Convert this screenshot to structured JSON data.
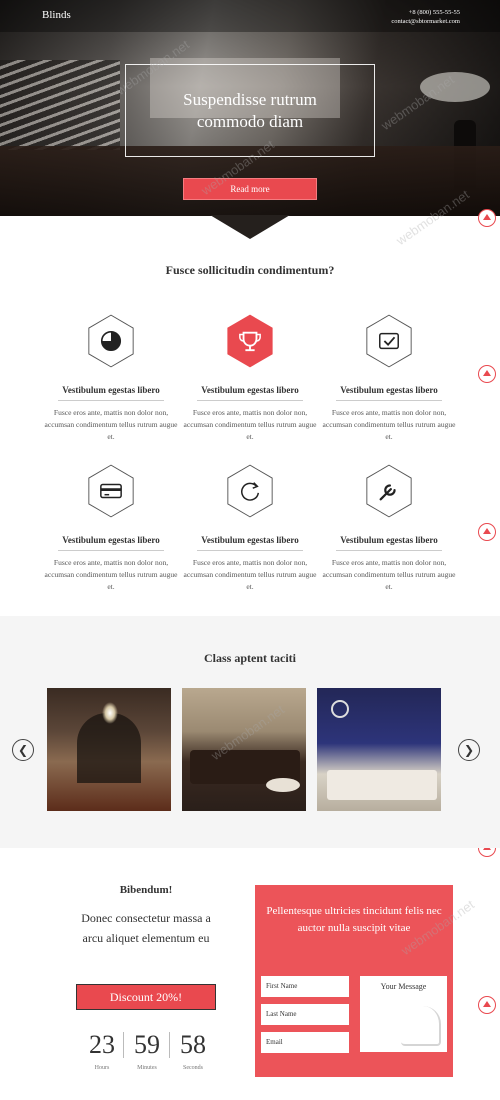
{
  "header": {
    "brand": "Blinds",
    "phone": "+8 (800) 555-55-55",
    "email": "contact@sbtormarket.com"
  },
  "hero": {
    "title": "Suspendisse rutrum commodo diam",
    "button_label": "Read more"
  },
  "features": {
    "title": "Fusce sollicitudin condimentum?",
    "items": [
      {
        "icon": "pie-chart-icon",
        "title": "Vestibulum egestas libero",
        "text": "Fusce eros ante, mattis non dolor non, accumsan condimentum tellus rutrum augue et.",
        "active": false
      },
      {
        "icon": "trophy-icon",
        "title": "Vestibulum egestas libero",
        "text": "Fusce eros ante, mattis non dolor non, accumsan condimentum tellus rutrum augue et.",
        "active": true
      },
      {
        "icon": "check-icon",
        "title": "Vestibulum egestas libero",
        "text": "Fusce eros ante, mattis non dolor non, accumsan condimentum tellus rutrum augue et.",
        "active": false
      },
      {
        "icon": "credit-card-icon",
        "title": "Vestibulum egestas libero",
        "text": "Fusce eros ante, mattis non dolor non, accumsan condimentum tellus rutrum augue et.",
        "active": false
      },
      {
        "icon": "refresh-icon",
        "title": "Vestibulum egestas libero",
        "text": "Fusce eros ante, mattis non dolor non, accumsan condimentum tellus rutrum augue et.",
        "active": false
      },
      {
        "icon": "wrench-icon",
        "title": "Vestibulum egestas libero",
        "text": "Fusce eros ante, mattis non dolor non, accumsan condimentum tellus rutrum augue et.",
        "active": false
      }
    ]
  },
  "gallery": {
    "title": "Class aptent taciti",
    "prev_icon": "chevron-left-icon",
    "next_icon": "chevron-right-icon",
    "prev_glyph": "❮",
    "next_glyph": "❯"
  },
  "promo": {
    "title": "Bibendum!",
    "text": "Donec consectetur massa a arcu aliquet elementum eu",
    "button_label": "Discount 20%!",
    "countdown": [
      {
        "value": "23",
        "label": "Hours"
      },
      {
        "value": "59",
        "label": "Minutes"
      },
      {
        "value": "58",
        "label": "Seconds"
      }
    ]
  },
  "form": {
    "heading": "Pellentesque ultricies tincidunt felis nec auctor nulla suscipit vitae",
    "first_name_placeholder": "First Name",
    "last_name_placeholder": "Last Name",
    "email_placeholder": "Email",
    "message_placeholder": "Your Message"
  },
  "watermark": "webmoban.net",
  "colors": {
    "accent": "#e9494f",
    "form_bg": "#ec5459",
    "gallery_bg": "#f5f5f5"
  }
}
